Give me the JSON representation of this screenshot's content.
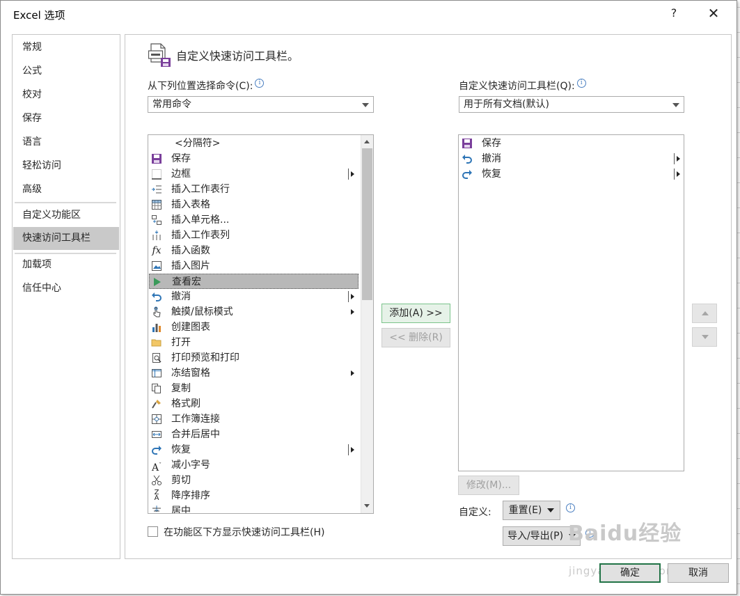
{
  "window": {
    "title": "Excel 选项",
    "help": "?",
    "close": "✕"
  },
  "sidebar": {
    "items": [
      {
        "label": "常规"
      },
      {
        "label": "公式"
      },
      {
        "label": "校对"
      },
      {
        "label": "保存"
      },
      {
        "label": "语言"
      },
      {
        "label": "轻松访问"
      },
      {
        "label": "高级"
      },
      {
        "label": "自定义功能区"
      },
      {
        "label": "快速访问工具栏",
        "selected": true
      },
      {
        "label": "加载项"
      },
      {
        "label": "信任中心"
      }
    ]
  },
  "main": {
    "heading": "自定义快速访问工具栏。",
    "choose_label": "从下列位置选择命令(C):",
    "choose_select": "常用命令",
    "customize_label": "自定义快速访问工具栏(Q):",
    "customize_select": "用于所有文档(默认)",
    "commands": [
      {
        "label": "<分隔符>",
        "icon": "separator-icon"
      },
      {
        "label": "保存",
        "icon": "save-icon"
      },
      {
        "label": "边框",
        "icon": "border-icon",
        "submenu": "split"
      },
      {
        "label": "插入工作表行",
        "icon": "insert-row-icon"
      },
      {
        "label": "插入表格",
        "icon": "insert-table-icon"
      },
      {
        "label": "插入单元格...",
        "icon": "insert-cells-icon"
      },
      {
        "label": "插入工作表列",
        "icon": "insert-column-icon"
      },
      {
        "label": "插入函数",
        "icon": "function-icon"
      },
      {
        "label": "插入图片",
        "icon": "picture-icon"
      },
      {
        "label": "查看宏",
        "icon": "macro-icon",
        "selected": true
      },
      {
        "label": "撤消",
        "icon": "undo-icon",
        "submenu": "split"
      },
      {
        "label": "触摸/鼠标模式",
        "icon": "touch-mode-icon",
        "submenu": "arrow"
      },
      {
        "label": "创建图表",
        "icon": "chart-icon"
      },
      {
        "label": "打开",
        "icon": "open-folder-icon"
      },
      {
        "label": "打印预览和打印",
        "icon": "print-preview-icon"
      },
      {
        "label": "冻结窗格",
        "icon": "freeze-panes-icon",
        "submenu": "arrow"
      },
      {
        "label": "复制",
        "icon": "copy-icon"
      },
      {
        "label": "格式刷",
        "icon": "format-painter-icon"
      },
      {
        "label": "工作簿连接",
        "icon": "connections-icon"
      },
      {
        "label": "合并后居中",
        "icon": "merge-center-icon"
      },
      {
        "label": "恢复",
        "icon": "redo-icon",
        "submenu": "split"
      },
      {
        "label": "减小字号",
        "icon": "decrease-font-icon"
      },
      {
        "label": "剪切",
        "icon": "cut-icon"
      },
      {
        "label": "降序排序",
        "icon": "sort-desc-icon"
      },
      {
        "label": "居中",
        "icon": "center-icon"
      }
    ],
    "toolbar_items": [
      {
        "label": "保存",
        "icon": "save-icon"
      },
      {
        "label": "撤消",
        "icon": "undo-icon",
        "submenu": "split"
      },
      {
        "label": "恢复",
        "icon": "redo-icon",
        "submenu": "split"
      }
    ],
    "add_button": "添加(A) >>",
    "remove_button": "<< 删除(R)",
    "modify_button": "修改(M)...",
    "customize_text": "自定义:",
    "reset_button": "重置(E)",
    "import_export_button": "导入/导出(P)",
    "show_below_checkbox": "在功能区下方显示快速访问工具栏(H)",
    "show_below_checked": false
  },
  "footer": {
    "ok_button": "确定",
    "cancel_button": "取消"
  },
  "watermark": {
    "logo": "Baidu经验",
    "url": "jingyan.baidu.com"
  },
  "colors": {
    "accent": "#217346",
    "selection": "#c9c9c9",
    "save_purple": "#7a3f9b",
    "undo_blue": "#2e75b6"
  }
}
